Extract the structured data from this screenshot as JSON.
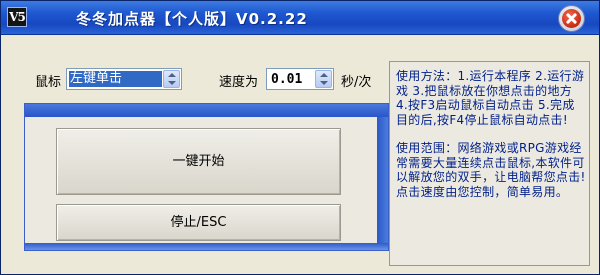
{
  "window": {
    "title": "冬冬加点器【个人版】V0.2.22",
    "app_icon_text": "V5"
  },
  "controls": {
    "mouse_label": "鼠标",
    "mouse_selected": "左键单击",
    "speed_label": "速度为",
    "speed_value": "0.01",
    "unit_label": "秒/次"
  },
  "buttons": {
    "start_label": "一键开始",
    "stop_label": "停止/ESC"
  },
  "info": {
    "usage": "使用方法：1.运行本程序 2.运行游戏 3.把鼠标放在你想点击的地方 4.按F3启动鼠标自动点击 5.完成目的后,按F4停止鼠标自动点击!",
    "scope": "使用范围：网络游戏或RPG游戏经常需要大量连续点击鼠标,本软件可以解放您的双手，让电脑帮您点击!点击速度由您控制，简单易用。"
  },
  "colors": {
    "titlebar": "#1f59d2",
    "selection": "#316ac5",
    "info_text": "#001f8a",
    "close_button": "#cc2e12"
  },
  "icons": [
    "app-icon",
    "close-icon",
    "dropdown-arrows-icon",
    "spin-arrows-icon"
  ]
}
